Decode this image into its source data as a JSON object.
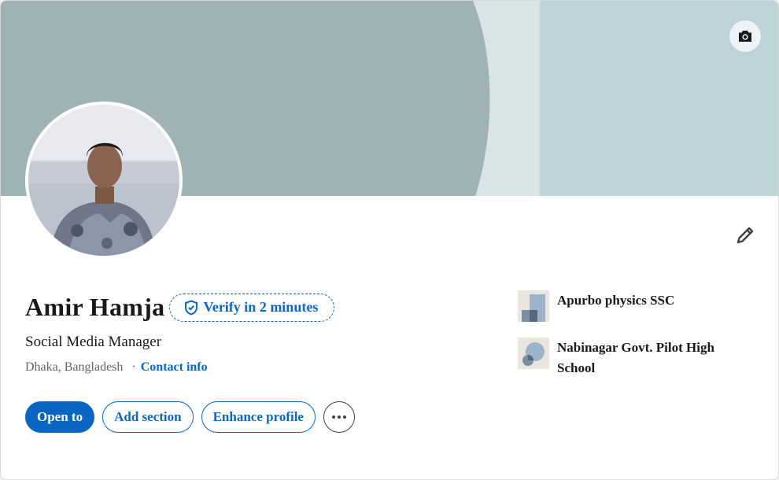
{
  "profile": {
    "name": "Amir Hamja",
    "verify_label": "Verify in 2 minutes",
    "headline": "Social Media Manager",
    "location": "Dhaka, Bangladesh",
    "separator": "·",
    "contact_label": "Contact info"
  },
  "actions": {
    "open_to": "Open to",
    "add_section": "Add section",
    "enhance_profile": "Enhance profile"
  },
  "education": [
    {
      "name": "Apurbo physics SSC"
    },
    {
      "name": "Nabinagar Govt. Pilot High School"
    }
  ],
  "icons": {
    "banner_camera": "camera-icon",
    "edit": "pencil-icon",
    "verify": "shield-check-icon",
    "more": "ellipsis-icon"
  },
  "colors": {
    "accent": "#0a66c2",
    "banner_dark": "#9fb2b5",
    "banner_light": "#d8e4e6",
    "banner_right": "#bed3d7"
  }
}
